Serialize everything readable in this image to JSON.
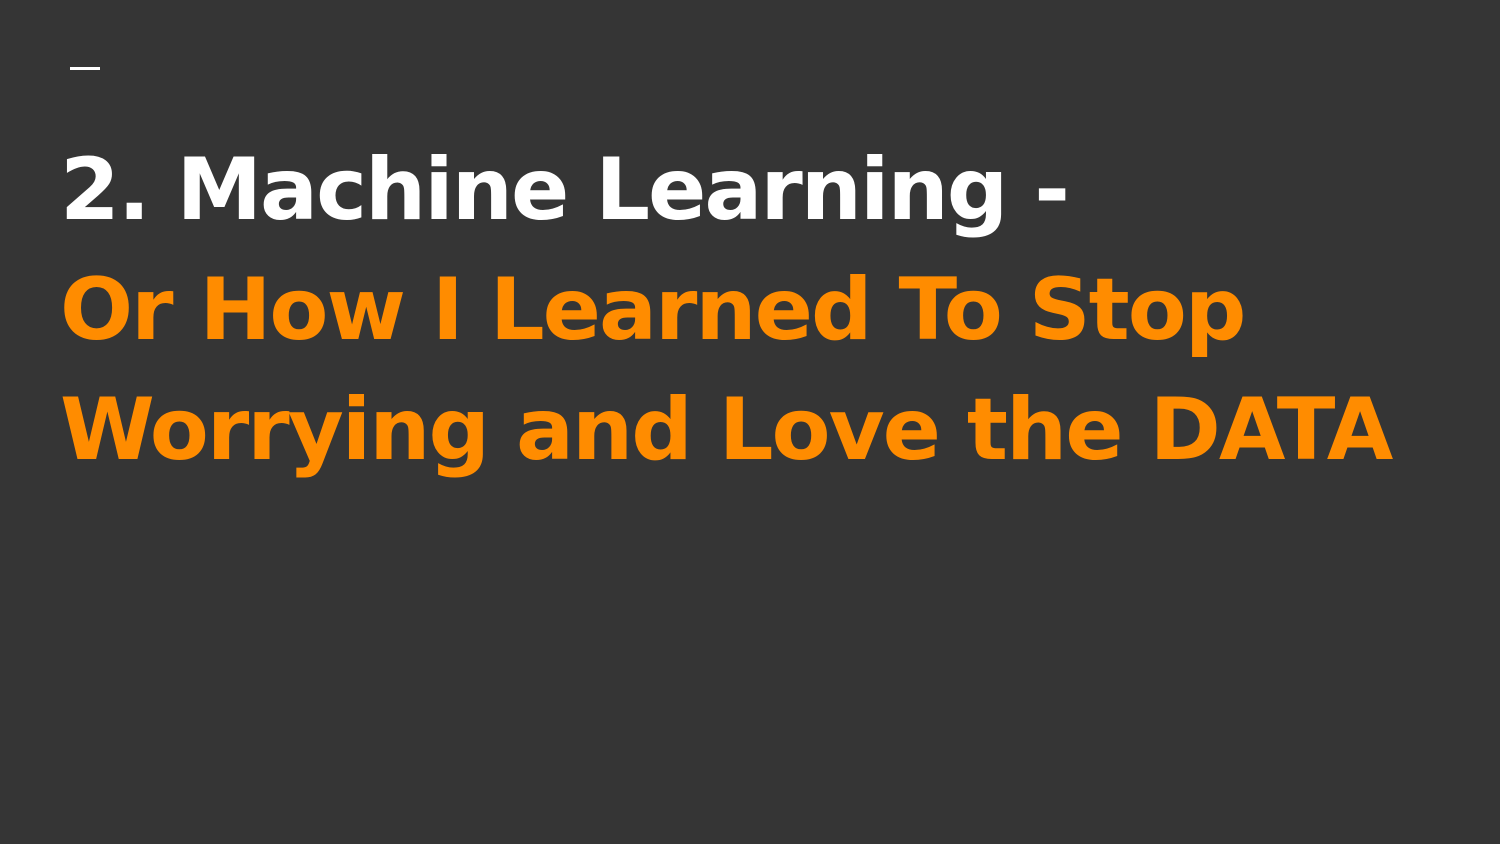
{
  "slide": {
    "title_line_1": "2. Machine Learning -",
    "title_line_2": "Or How I Learned To Stop",
    "title_line_3": "Worrying and Love the DATA"
  },
  "colors": {
    "background": "#353535",
    "title_primary": "#ffffff",
    "title_accent": "#ff8c00"
  }
}
